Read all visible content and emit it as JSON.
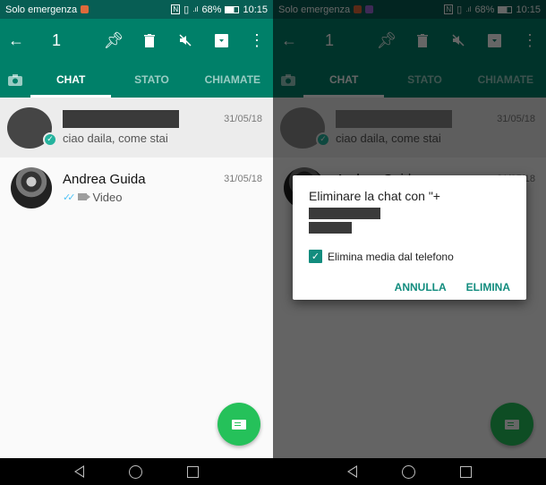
{
  "status": {
    "carrier": "Solo emergenza",
    "battery": "68%",
    "time": "10:15"
  },
  "appbar": {
    "selected_count": "1",
    "icons": [
      "back-arrow-icon",
      "pin-icon",
      "delete-icon",
      "mute-icon",
      "archive-icon",
      "more-vert-icon"
    ]
  },
  "tabs": [
    "CHAT",
    "STATO",
    "CHIAMATE"
  ],
  "chats": [
    {
      "name": "",
      "name_redacted": true,
      "date": "31/05/18",
      "preview": "ciao daila, come stai",
      "selected": true
    },
    {
      "name": "Andrea Guida",
      "date": "31/05/18",
      "preview": "Video",
      "selected": false
    }
  ],
  "dialog": {
    "title": "Eliminare la chat con \"+",
    "checkbox_label": "Elimina media dal telefono",
    "checkbox_checked": true,
    "cancel": "ANNULLA",
    "confirm": "ELIMINA"
  },
  "colors": {
    "primary": "#008069",
    "status_bar": "#075e54",
    "fab": "#25c15a",
    "accent": "#128c7e"
  }
}
